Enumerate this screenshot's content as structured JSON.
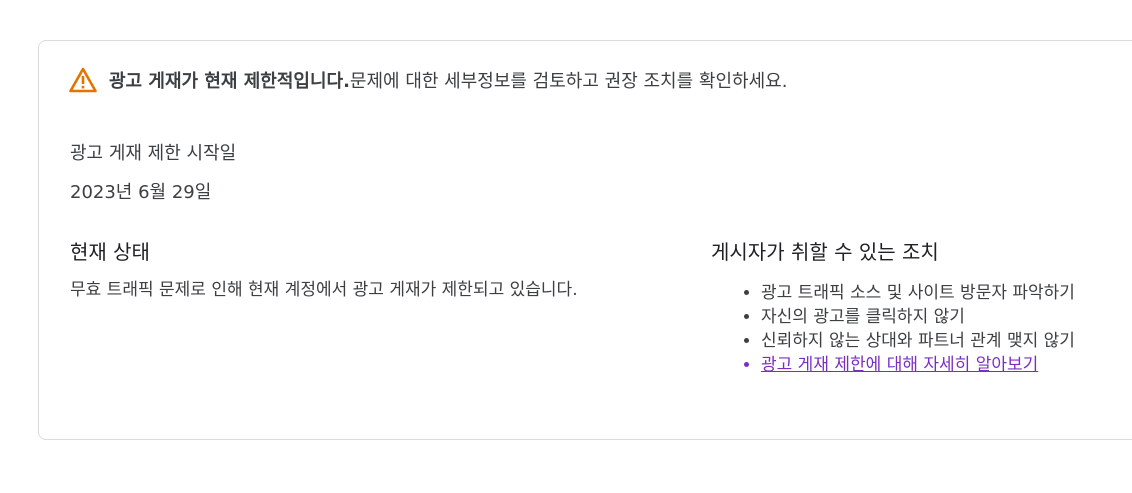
{
  "banner": {
    "icon": "warning-triangle-icon",
    "icon_color": "#e37400",
    "bold_text": "광고 게재가 현재 제한적입니다.",
    "text": " 문제에 대한 세부정보를 검토하고 권장 조치를 확인하세요."
  },
  "restriction": {
    "start_label": "광고 게재 제한 시작일",
    "start_date": "2023년 6월 29일"
  },
  "status": {
    "heading": "현재 상태",
    "text": "무효 트래픽 문제로 인해 현재 계정에서 광고 게재가 제한되고 있습니다."
  },
  "actions": {
    "heading": "게시자가 취할 수 있는 조치",
    "items": [
      "광고 트래픽 소스 및 사이트 방문자 파악하기",
      "자신의 광고를 클릭하지 않기",
      "신뢰하지 않는 상대와 파트너 관계 맺지 않기"
    ],
    "learn_more_link": "광고 게재 제한에 대해 자세히 알아보기",
    "link_color": "#7b2fbf"
  }
}
